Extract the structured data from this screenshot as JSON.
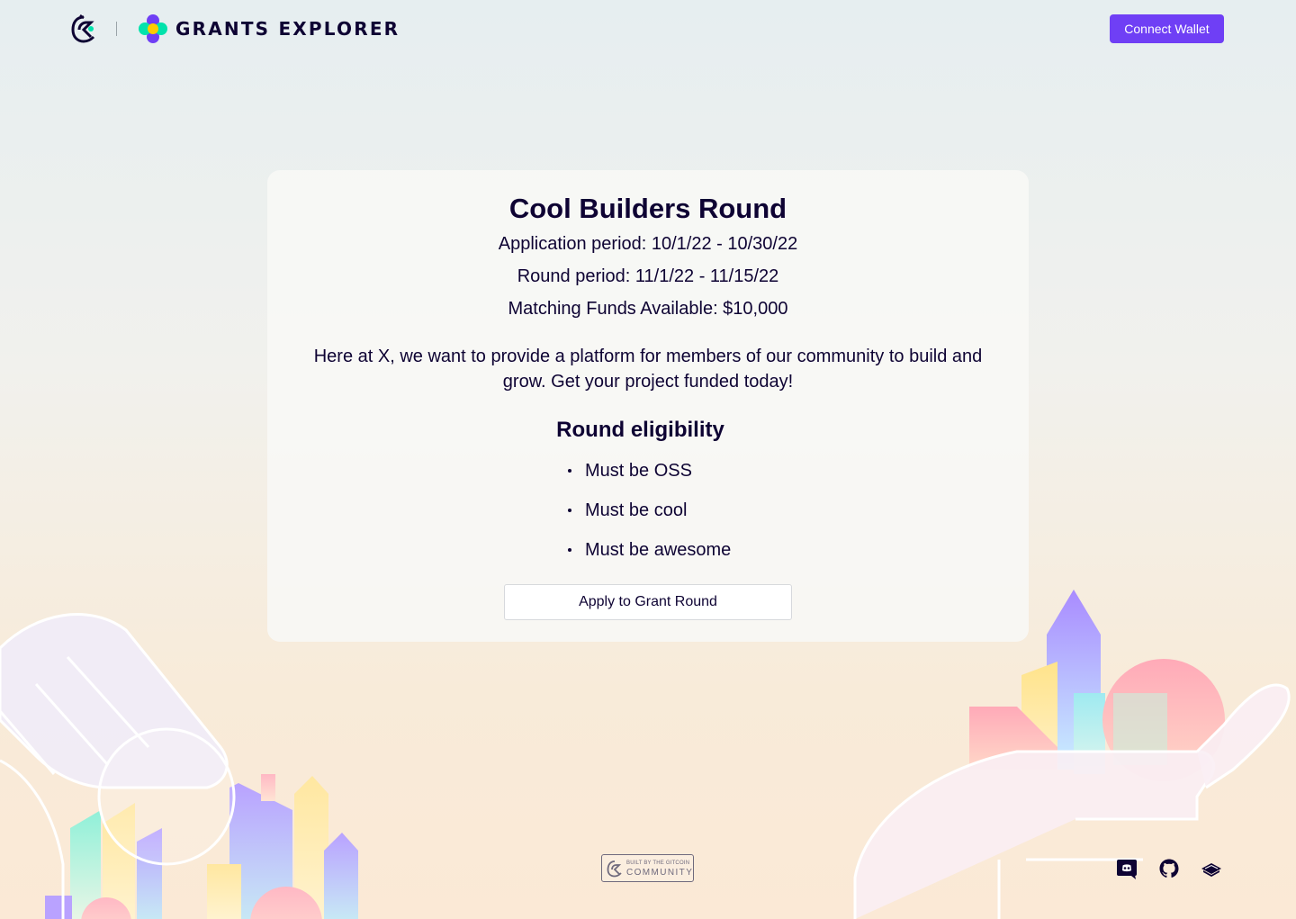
{
  "header": {
    "brand_title": "GRANTS EXPLORER",
    "connect_wallet_label": "Connect Wallet",
    "accent_color": "#6f3ff5"
  },
  "round": {
    "title": "Cool Builders Round",
    "application_period": "Application period: 10/1/22 - 10/30/22",
    "round_period": "Round period: 11/1/22 - 11/15/22",
    "matching_funds": "Matching Funds Available: $10,000",
    "description": "Here at X, we want to provide a platform for members of our community to build and grow. Get your project funded today!",
    "eligibility_heading": "Round eligibility",
    "eligibility_items": [
      "Must be OSS",
      "Must be cool",
      "Must be awesome"
    ],
    "apply_label": "Apply to Grant Round"
  },
  "footer": {
    "badge_top": "BUILT BY THE GITCOIN",
    "badge_main": "COMMUNITY",
    "icons": [
      "discord-icon",
      "github-icon",
      "docs-icon"
    ]
  }
}
